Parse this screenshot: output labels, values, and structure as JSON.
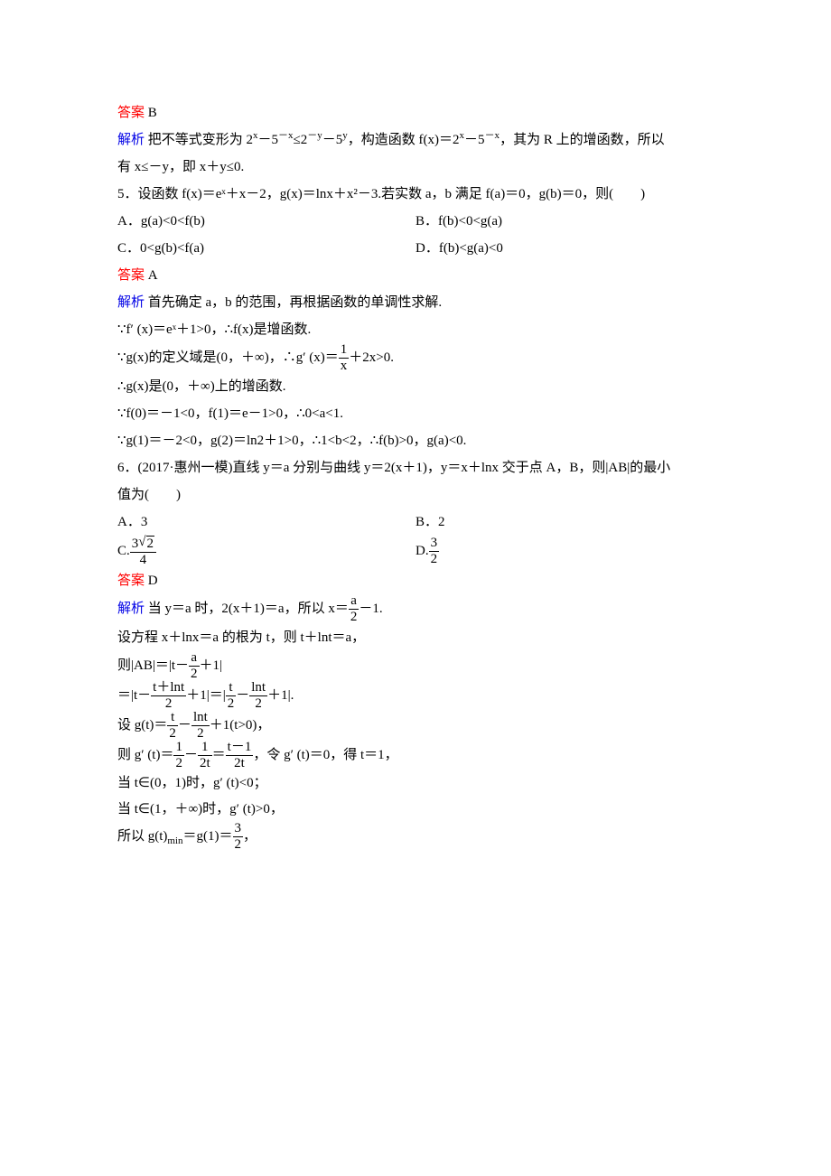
{
  "labels": {
    "answer": "答案",
    "explain": "解析"
  },
  "q4": {
    "answer": "B",
    "explain_intro": "把不等式变形为 2",
    "explain_p1_a": "－5",
    "explain_p1_b": "≤2",
    "explain_p1_c": "－5",
    "explain_p1_d": "，构造函数 f(x)＝2",
    "explain_p1_e": "－5",
    "explain_p1_f": "，其为 R 上的增函数，所以",
    "sup_x": "x",
    "sup_nx": "－x",
    "sup_ny": "－y",
    "sup_y": "y",
    "explain_line2": "有 x≤－y，即 x＋y≤0."
  },
  "q5": {
    "stem": "5．设函数 f(x)＝eˣ＋x－2，g(x)＝lnx＋x²－3.若实数 a，b 满足 f(a)＝0，g(b)＝0，则(　　)",
    "optA": "A．g(a)<0<f(b)",
    "optB": "B．f(b)<0<g(a)",
    "optC": "C．0<g(b)<f(a)",
    "optD": "D．f(b)<g(a)<0",
    "answer": "A",
    "explain1": "首先确定 a，b 的范围，再根据函数的单调性求解.",
    "explain2": "∵f′ (x)＝eˣ＋1>0，∴f(x)是增函数.",
    "explain3a": "∵g(x)的定义域是(0，＋∞)，∴g′ (x)＝",
    "explain3b": "＋2x>0.",
    "frac1_num": "1",
    "frac1_den": "x",
    "explain4": "∴g(x)是(0，＋∞)上的增函数.",
    "explain5": "∵f(0)＝－1<0，f(1)＝e－1>0，∴0<a<1.",
    "explain6": "∵g(1)＝－2<0，g(2)＝ln2＋1>0，∴1<b<2，∴f(b)>0，g(a)<0."
  },
  "q6": {
    "stem": "6．(2017·惠州一模)直线 y＝a 分别与曲线 y＝2(x＋1)，y＝x＋lnx 交于点 A，B，则|AB|的最小",
    "stem2": "值为(　　)",
    "optA": "A．3",
    "optB": "B．2",
    "optC_pre": "C.",
    "optC_num": "3",
    "optC_in": "2",
    "optC_den": "4",
    "optD_pre": "D.",
    "optD_num": "3",
    "optD_den": "2",
    "answer": "D",
    "explain1a": "当 y＝a 时，2(x＋1)＝a，所以 x＝",
    "explain1b": "－1.",
    "frac_a_num": "a",
    "frac_a_den": "2",
    "explain2": "设方程 x＋lnx＝a 的根为 t，则 t＋lnt＝a，",
    "explain3a": "则|AB|＝|t－",
    "explain3b": "＋1|",
    "explain4a": "＝|t－",
    "explain4_mid_num": "t＋lnt",
    "explain4_mid_den": "2",
    "explain4b": "＋1|＝|",
    "explain4c": "－",
    "explain4d": "＋1|.",
    "frac_t_num": "t",
    "frac_t_den": "2",
    "frac_lnt_num": "lnt",
    "frac_lnt_den": "2",
    "explain5a": "设 g(t)＝",
    "explain5b": "－",
    "explain5c": "＋1(t>0)，",
    "explain6a": "则 g′ (t)＝",
    "frac_half_num": "1",
    "frac_half_den": "2",
    "explain6b": "－",
    "frac_1_2t_num": "1",
    "frac_1_2t_den": "2t",
    "explain6c": "＝",
    "frac_t1_num": "t－1",
    "frac_t1_den": "2t",
    "explain6d": "，令 g′ (t)＝0，得 t＝1，",
    "explain7": "当 t∈(0，1)时，g′ (t)<0；",
    "explain8": "当 t∈(1，＋∞)时，g′ (t)>0，",
    "explain9a": "所以 g(t)",
    "explain9_min": "min",
    "explain9b": "＝g(1)＝",
    "explain9c": "，"
  }
}
